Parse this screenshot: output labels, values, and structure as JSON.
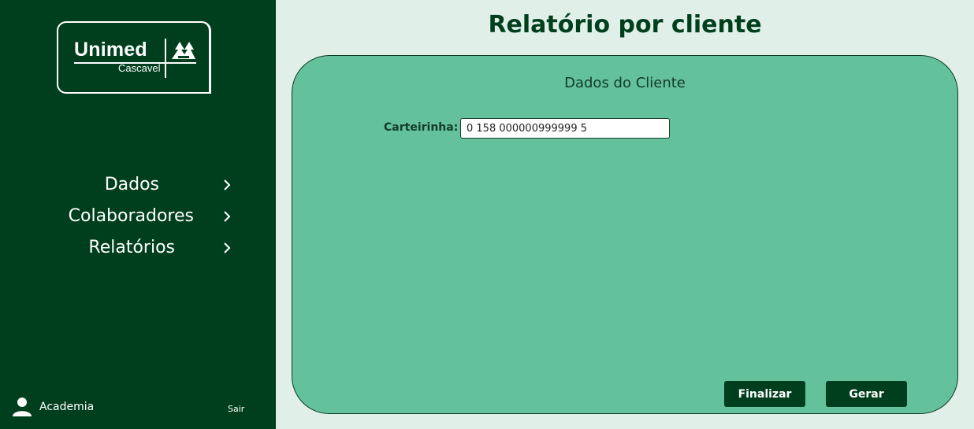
{
  "sidebar": {
    "logo": {
      "name": "Unimed",
      "subtitle": "Cascavel"
    },
    "nav": [
      {
        "label": "Dados",
        "icon": "chevron-right-icon"
      },
      {
        "label": "Colaboradores",
        "icon": "chevron-right-icon"
      },
      {
        "label": "Relatórios",
        "icon": "chevron-right-icon"
      }
    ],
    "user": {
      "name": "Academia",
      "icon": "user-icon"
    },
    "logout_label": "Sair"
  },
  "page": {
    "title": "Relatório por cliente"
  },
  "form": {
    "section_title": "Dados do Cliente",
    "card_label": "Carteirinha:",
    "card_value": "0 158 000000999999 5",
    "finalize_label": "Finalizar",
    "generate_label": "Gerar"
  },
  "colors": {
    "sidebar_bg": "#003f1d",
    "page_bg": "#e0efe8",
    "card_bg": "#63c19b",
    "title_color": "#003f1d"
  }
}
